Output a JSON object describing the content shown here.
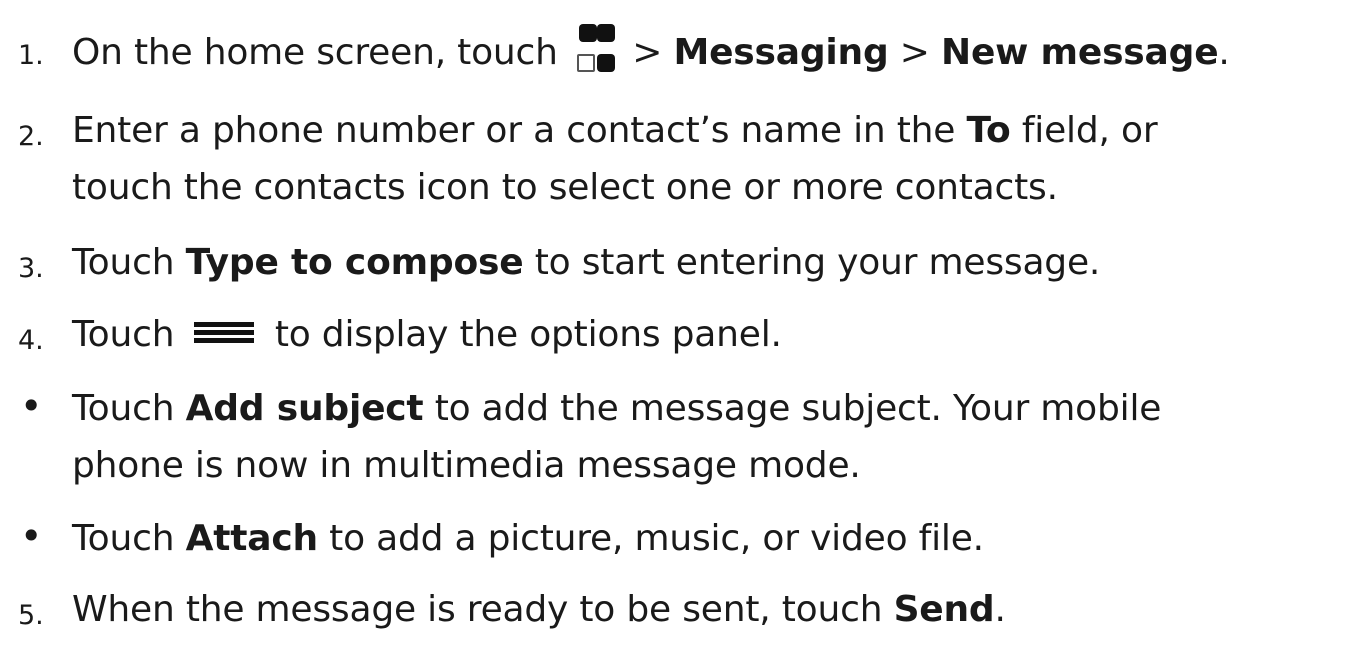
{
  "steps": [
    {
      "marker": "1.",
      "parts": [
        "On the home screen, touch ",
        " > ",
        "Messaging",
        " > ",
        "New message",
        "."
      ]
    },
    {
      "marker": "2.",
      "parts": [
        "Enter a phone number or a contact’s name in the ",
        "To",
        " field, or"
      ],
      "line2": "touch the contacts icon to select one or more contacts."
    },
    {
      "marker": "3.",
      "parts": [
        "Touch ",
        "Type to compose",
        " to start entering your message."
      ]
    },
    {
      "marker": "4.",
      "parts": [
        "Touch ",
        " to display the options panel."
      ]
    },
    {
      "marker": "•",
      "parts": [
        "Touch ",
        "Add subject",
        " to add the message subject. Your mobile"
      ],
      "line2": "phone is now in multimedia message mode."
    },
    {
      "marker": "•",
      "parts": [
        "Touch ",
        "Attach",
        " to add a picture, music, or video file."
      ]
    },
    {
      "marker": "5.",
      "parts": [
        "When the message is ready to be sent, touch ",
        "Send",
        "."
      ]
    }
  ],
  "icons": {
    "apps": "apps-grid-icon",
    "menu": "menu-icon"
  }
}
